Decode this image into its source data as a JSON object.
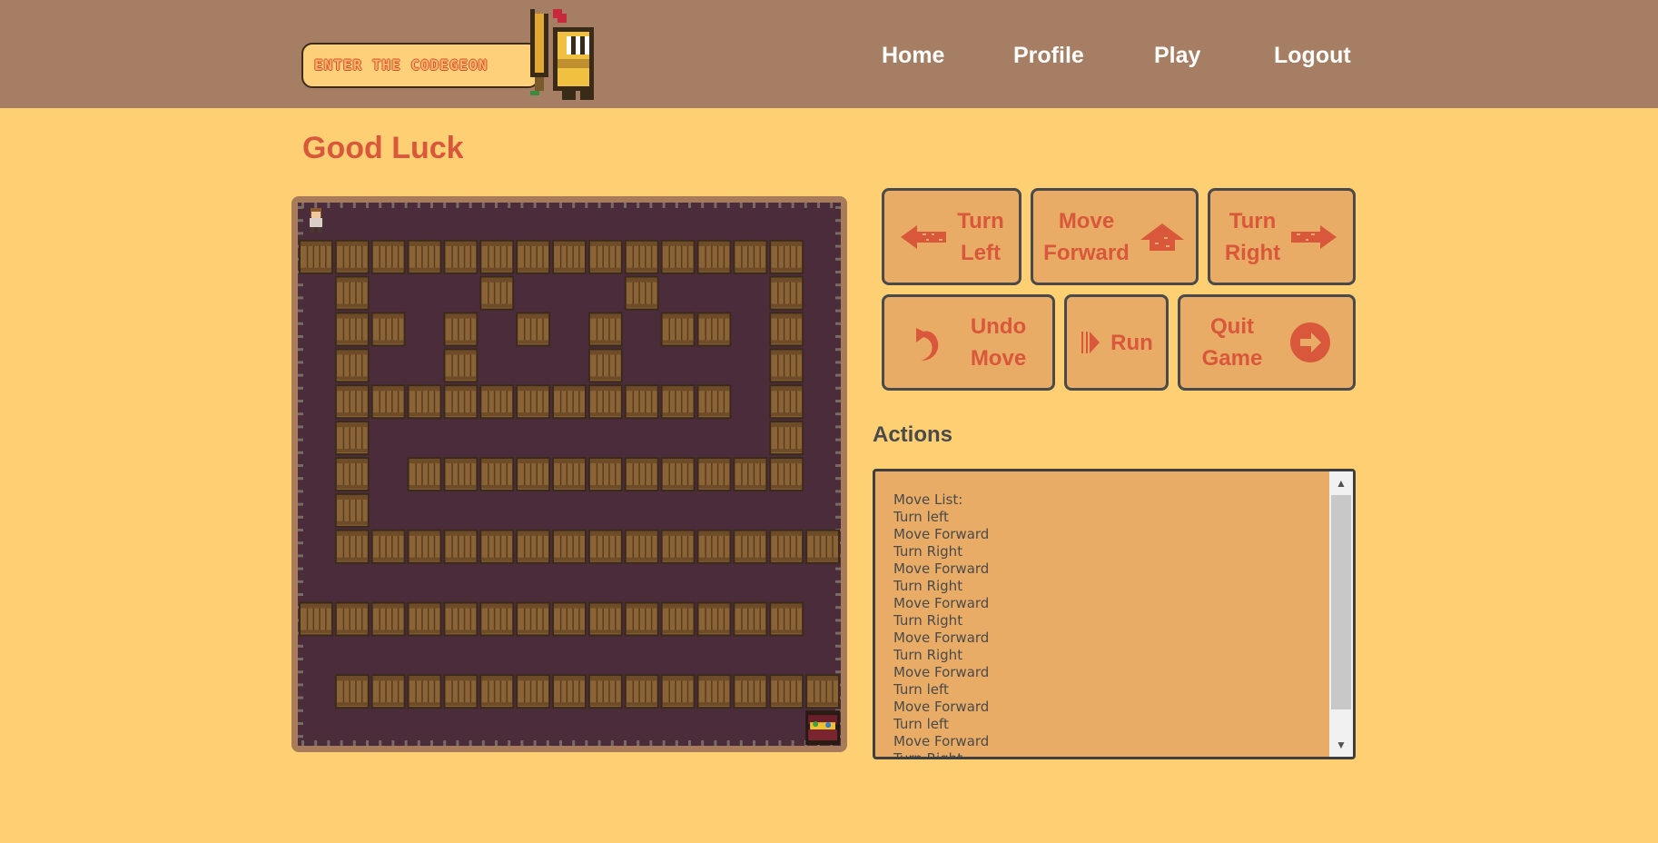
{
  "header": {
    "logo_text": "ENTER THE CODEGEON",
    "nav": [
      "Home",
      "Profile",
      "Play",
      "Logout"
    ]
  },
  "page": {
    "title": "Good Luck"
  },
  "controls": {
    "turn_left": [
      "Turn",
      "Left"
    ],
    "move_forward": [
      "Move",
      "Forward"
    ],
    "turn_right": [
      "Turn",
      "Right"
    ],
    "undo_move": [
      "Undo",
      "Move"
    ],
    "run": "Run",
    "quit_game": [
      "Quit",
      "Game"
    ]
  },
  "actions": {
    "title": "Actions",
    "moves": [
      "Move List:",
      "Turn left",
      "Move Forward",
      "Turn Right",
      "Move Forward",
      "Turn Right",
      "Move Forward",
      "Turn Right",
      "Move Forward",
      "Turn Right",
      "Move Forward",
      "Turn left",
      "Move Forward",
      "Turn left",
      "Move Forward",
      "Turn Right"
    ]
  },
  "maze": {
    "grid": [
      "P..............",
      "##############.",
      ".#...#...#...#.",
      ".##.#.#.#.##.#.",
      ".#..#...#....#.",
      ".###########.#.",
      ".#...........#.",
      ".#.###########.",
      ".#.............",
      ".##############",
      "...............",
      "##############.",
      "...............",
      ".##############",
      "..............T"
    ]
  },
  "colors": {
    "accent": "#d9573a",
    "background": "#ffd073",
    "header": "#a67e63",
    "button": "#e8ac66",
    "floor": "#4a2c3b",
    "crate": "#8a6437"
  }
}
